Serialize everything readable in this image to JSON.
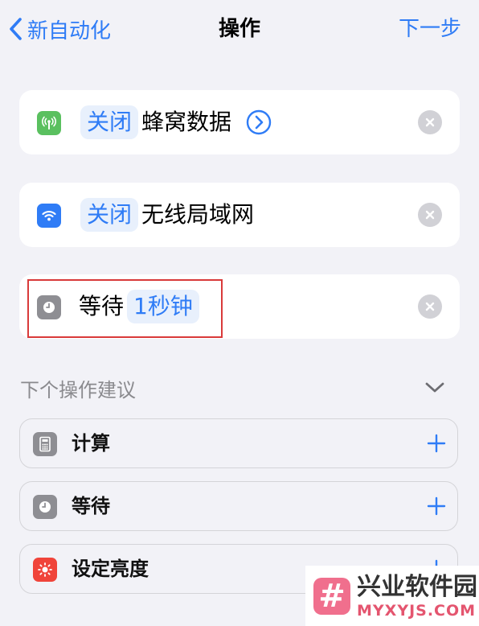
{
  "nav": {
    "back_label": "新自动化",
    "title": "操作",
    "next_label": "下一步"
  },
  "actions": [
    {
      "icon": "cellular-icon",
      "param": "关闭",
      "label": "蜂窝数据",
      "icon_color": "#5ac05f"
    },
    {
      "icon": "wifi-icon",
      "param": "关闭",
      "label": "无线局域网",
      "icon_color": "#2f7cf6"
    },
    {
      "icon": "clock-icon",
      "label": "等待",
      "param": "1秒钟",
      "icon_color": "#8e8e93"
    }
  ],
  "suggestions": {
    "header": "下个操作建议",
    "items": [
      {
        "icon": "calculator-icon",
        "label": "计算",
        "icon_color": "#8e8e93"
      },
      {
        "icon": "clock-icon",
        "label": "等待",
        "icon_color": "#8e8e93"
      },
      {
        "icon": "brightness-icon",
        "label": "设定亮度",
        "icon_color": "#f0443a"
      }
    ]
  },
  "watermark": {
    "mark": "#",
    "name": "兴业软件园",
    "domain": "MYXYJS.COM"
  },
  "colors": {
    "accent": "#2f7cf6",
    "background": "#f2f2f7",
    "highlight": "#d93a3a"
  }
}
